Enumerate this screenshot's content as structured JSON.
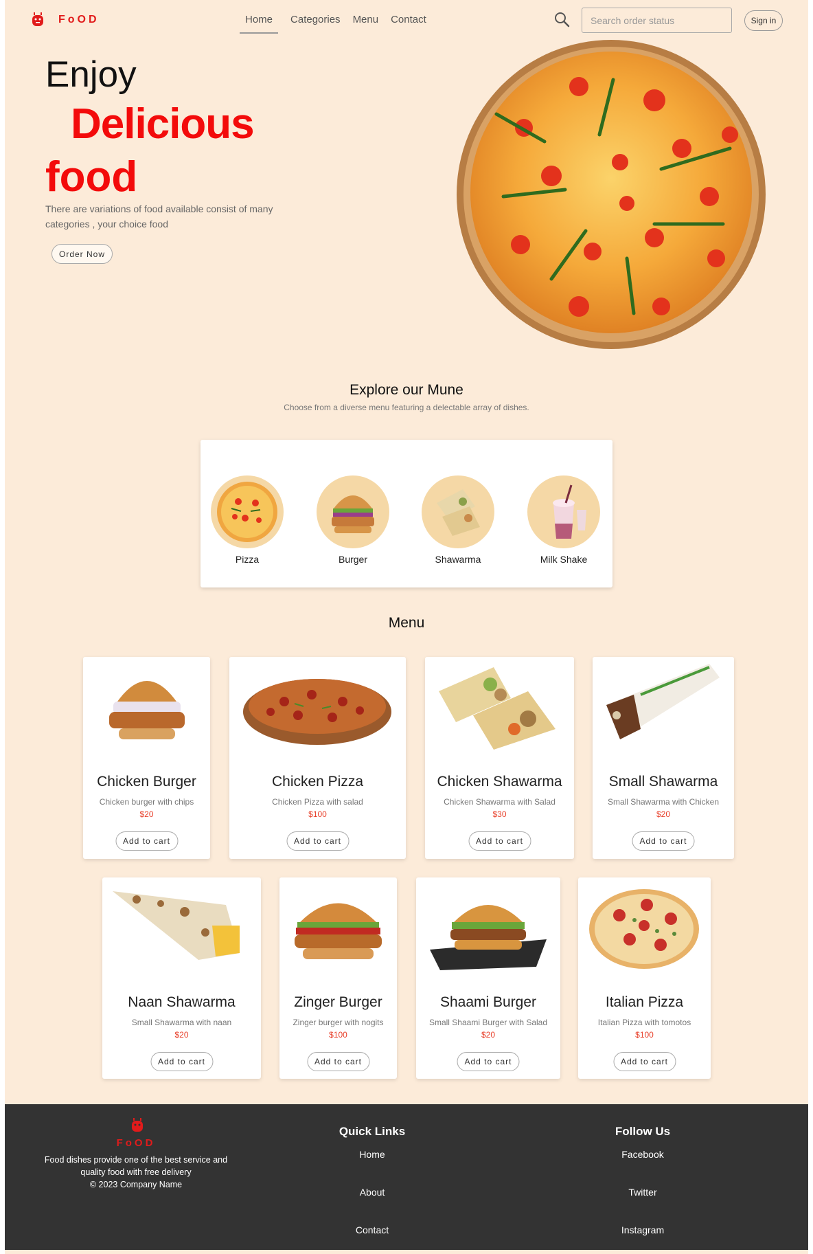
{
  "nav": {
    "brand": "FoOD",
    "links": [
      "Home",
      "Categories",
      "Menu",
      "Contact"
    ],
    "search_placeholder": "Search order status",
    "signin": "Sign in"
  },
  "hero": {
    "line1": "Enjoy",
    "line2": "Delicious",
    "line3": "food",
    "description": "There are variations of food available consist of many categories , your choice food",
    "order_button": "Order Now"
  },
  "explore": {
    "title": "Explore our Mune",
    "subtitle": "Choose from a diverse menu featuring a delectable array of dishes.",
    "categories": [
      "Pizza",
      "Burger",
      "Shawarma",
      "Milk Shake"
    ]
  },
  "menu": {
    "title": "Menu",
    "items": [
      {
        "name": "Chicken Burger",
        "desc": "Chicken burger with chips",
        "price": "$20",
        "button": "Add to cart"
      },
      {
        "name": "Chicken Pizza",
        "desc": "Chicken Pizza with salad",
        "price": "$100",
        "button": "Add to cart"
      },
      {
        "name": "Chicken Shawarma",
        "desc": "Chicken Shawarma with Salad",
        "price": "$30",
        "button": "Add to cart"
      },
      {
        "name": "Small Shawarma",
        "desc": "Small Shawarma with Chicken",
        "price": "$20",
        "button": "Add to cart"
      },
      {
        "name": "Naan Shawarma",
        "desc": "Small Shawarma with naan",
        "price": "$20",
        "button": "Add to cart"
      },
      {
        "name": "Zinger Burger",
        "desc": "Zinger burger with nogits",
        "price": "$100",
        "button": "Add to cart"
      },
      {
        "name": "Shaami Burger",
        "desc": "Small Shaami Burger with Salad",
        "price": "$20",
        "button": "Add to cart"
      },
      {
        "name": "Italian Pizza",
        "desc": "Italian Pizza with tomotos",
        "price": "$100",
        "button": "Add to cart"
      }
    ]
  },
  "footer": {
    "brand": "FoOD",
    "description": "Food dishes provide one of the best service and quality food with free delivery",
    "copyright": "© 2023 Company Name",
    "quick_links_title": "Quick Links",
    "quick_links": [
      "Home",
      "About",
      "Contact"
    ],
    "follow_title": "Follow Us",
    "follow_links": [
      "Facebook",
      "Twitter",
      "Instagram"
    ]
  },
  "colors": {
    "background": "#fcebd9",
    "accent": "#f30b0b",
    "price": "#e8402b",
    "footer": "#333333",
    "category_circle": "#f5d8a6"
  },
  "icons": [
    "robot-logo-icon",
    "search-icon"
  ]
}
